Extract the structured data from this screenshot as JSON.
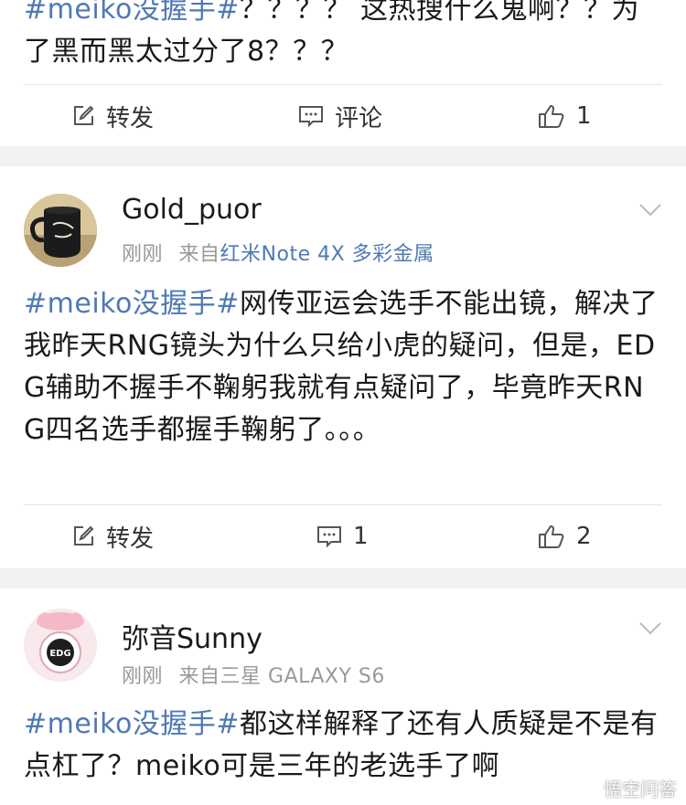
{
  "post0": {
    "hashtag": "#meiko没握手#",
    "text": "？？？？ 这热搜什么鬼啊？？为了黑而黑太过分了8？？？",
    "actions": {
      "repost": "转发",
      "comment": "评论",
      "like": "1"
    }
  },
  "post1": {
    "user": "Gold_puor",
    "time": "刚刚",
    "from_label": "来自",
    "source": "红米Note 4X 多彩金属",
    "hashtag": "#meiko没握手#",
    "text": "网传亚运会选手不能出镜，解决了我昨天RNG镜头为什么只给小虎的疑问，但是，EDG辅助不握手不鞠躬我就有点疑问了，毕竟昨天RNG四名选手都握手鞠躬了。。。",
    "actions": {
      "repost": "转发",
      "comment": "1",
      "like": "2"
    }
  },
  "post2": {
    "user": "弥音Sunny",
    "time": "刚刚",
    "from_label": "来自",
    "source": "三星 GALAXY S6",
    "hashtag": "#meiko没握手#",
    "text": "都这样解释了还有人质疑是不是有点杠了？meiko可是三年的老选手了啊",
    "avatar_text": "EDG"
  },
  "watermark": "悟空问答",
  "colors": {
    "link": "#4f79b4",
    "meta": "#999999",
    "gap": "#f2f2f2"
  },
  "icons": {
    "repost": "edit-icon",
    "comment": "comment-icon",
    "like": "thumbs-up-icon",
    "more": "chevron-down-icon"
  }
}
